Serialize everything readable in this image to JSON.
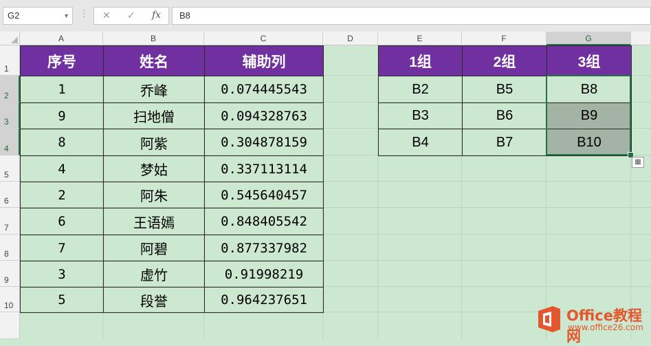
{
  "formula_bar": {
    "name_box": "G2",
    "cancel_icon": "✕",
    "enter_icon": "✓",
    "fx_label": "fx",
    "formula": "B8"
  },
  "columns": [
    "A",
    "B",
    "C",
    "D",
    "E",
    "F",
    "G"
  ],
  "selected_column": "G",
  "rows": [
    "1",
    "2",
    "3",
    "4",
    "5",
    "6",
    "7",
    "8",
    "9",
    "10"
  ],
  "selected_rows": [
    "2",
    "3",
    "4"
  ],
  "table_left": {
    "headers": [
      "序号",
      "姓名",
      "辅助列"
    ],
    "rows": [
      [
        "1",
        "乔峰",
        "0.074445543"
      ],
      [
        "9",
        "扫地僧",
        "0.094328763"
      ],
      [
        "8",
        "阿紫",
        "0.304878159"
      ],
      [
        "4",
        "梦姑",
        "0.337113114"
      ],
      [
        "2",
        "阿朱",
        "0.545640457"
      ],
      [
        "6",
        "王语嫣",
        "0.848405542"
      ],
      [
        "7",
        "阿碧",
        "0.877337982"
      ],
      [
        "3",
        "虚竹",
        "0.91998219"
      ],
      [
        "5",
        "段誉",
        "0.964237651"
      ]
    ]
  },
  "table_right": {
    "headers": [
      "1组",
      "2组",
      "3组"
    ],
    "rows": [
      [
        "B2",
        "B5",
        "B8"
      ],
      [
        "B3",
        "B6",
        "B9"
      ],
      [
        "B4",
        "B7",
        "B10"
      ]
    ]
  },
  "watermark": {
    "title": "Office教程网",
    "url": "www.office26.com"
  },
  "colors": {
    "header_fill": "#7030a0",
    "sheet_fill": "#cde8d0",
    "selection_border": "#217346"
  }
}
